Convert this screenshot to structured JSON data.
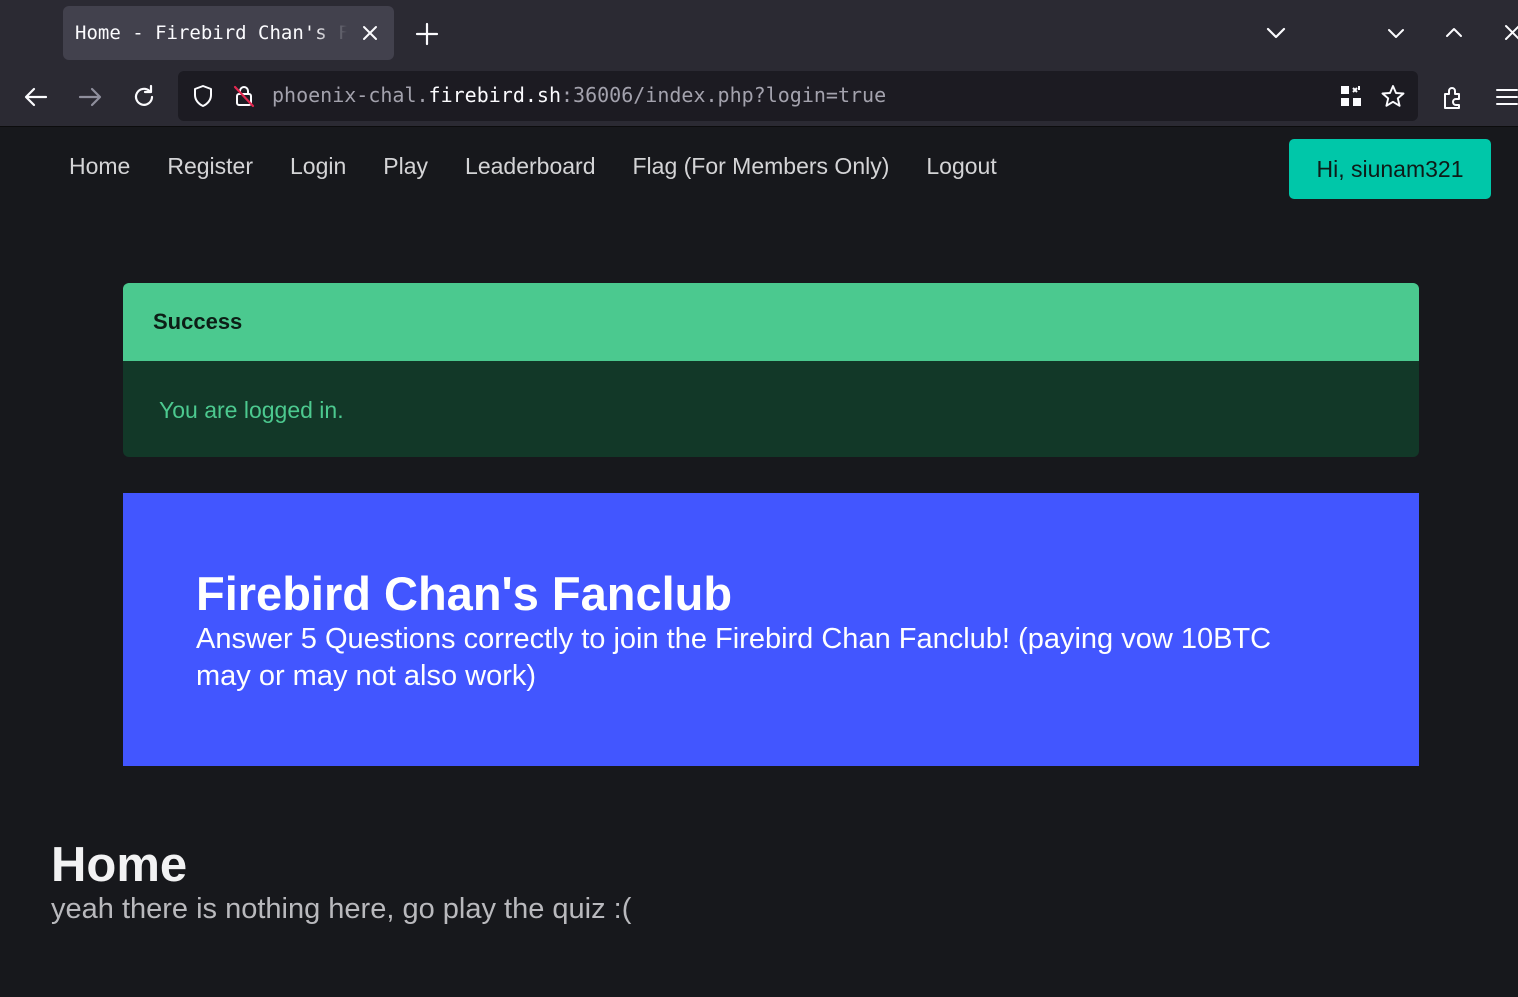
{
  "browser": {
    "tab_title": "Home - Firebird Chan's Fanclub",
    "url": {
      "prefix": "phoenix-chal.",
      "host": "firebird.sh",
      "suffix": ":36006/index.php?login=true"
    }
  },
  "site_nav": {
    "items": [
      "Home",
      "Register",
      "Login",
      "Play",
      "Leaderboard",
      "Flag (For Members Only)",
      "Logout"
    ],
    "user_greeting": "Hi, siunam321"
  },
  "alert": {
    "title": "Success",
    "message": "You are logged in."
  },
  "hero": {
    "title": "Firebird Chan's Fanclub",
    "subtitle": "Answer 5 Questions correctly to join the Firebird Chan Fanclub! (paying vow 10BTC may or may not also work)"
  },
  "home": {
    "title": "Home",
    "subtitle": "yeah there is nothing here, go play the quiz :("
  },
  "colors": {
    "alert_header": "#4bc98f",
    "alert_body": "#123828",
    "hero_bg": "#4256ff",
    "user_button": "#00c7a9"
  },
  "icons": [
    "close-icon",
    "plus-icon",
    "chevron-down-icon",
    "chevron-up-icon",
    "back-arrow-icon",
    "forward-arrow-icon",
    "reload-icon",
    "shield-icon",
    "insecure-lock-icon",
    "qr-code-icon",
    "bookmark-star-icon",
    "extensions-icon",
    "hamburger-menu-icon"
  ]
}
